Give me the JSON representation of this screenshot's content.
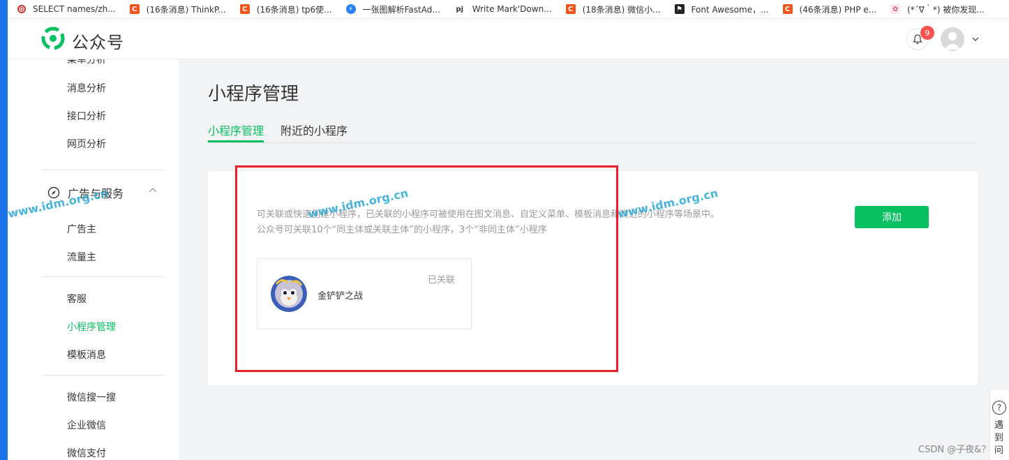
{
  "bookmarks": [
    {
      "icon": "qm-icon",
      "label": "SELECT names/zh..."
    },
    {
      "icon": "csdn-icon",
      "label": "(16条消息) ThinkP..."
    },
    {
      "icon": "csdn-icon",
      "label": "(16条消息) tp6使..."
    },
    {
      "icon": "fastadmin-icon",
      "label": "一张图解析FastAd..."
    },
    {
      "icon": "pj-icon",
      "label": "Write Mark'Down..."
    },
    {
      "icon": "csdn-icon",
      "label": "(18条消息) 微信小..."
    },
    {
      "icon": "fontawesome-icon",
      "label": "Font Awesome，..."
    },
    {
      "icon": "csdn-icon",
      "label": "(46条消息) PHP e..."
    },
    {
      "icon": "rabbit-icon",
      "label": "(*´∇｀*) 被你发现..."
    }
  ],
  "header": {
    "logo_text": "公众号",
    "notification_count": "9"
  },
  "sidebar": {
    "items_top": [
      "菜单分析",
      "消息分析",
      "接口分析",
      "网页分析"
    ],
    "group_title": "广告与服务",
    "items_group": [
      "广告主",
      "流量主"
    ],
    "items_mid": [
      "客服",
      "小程序管理",
      "模板消息"
    ],
    "items_bottom": [
      "微信搜一搜",
      "企业微信",
      "微信支付"
    ],
    "active_item": "小程序管理"
  },
  "main": {
    "title": "小程序管理",
    "tabs": [
      {
        "label": "小程序管理",
        "active": true
      },
      {
        "label": "附近的小程序",
        "active": false
      }
    ],
    "description_line1": "可关联或快速创建小程序，已关联的小程序可被使用在图文消息、自定义菜单、模板消息和附近的小程序等场景中。",
    "description_line2": "公众号可关联10个“同主体或关联主体”的小程序，3个“非同主体”小程序",
    "add_button": "添加",
    "linked_program": {
      "name": "金铲铲之战",
      "status": "已关联"
    }
  },
  "watermark": "www.idm.org.cn",
  "help": {
    "icon": "?",
    "text": "遇到问"
  },
  "csdn_mark": "CSDN @子夜&？",
  "colors": {
    "accent": "#07c160",
    "highlight_box": "#e8202a",
    "badge": "#fa5151"
  }
}
